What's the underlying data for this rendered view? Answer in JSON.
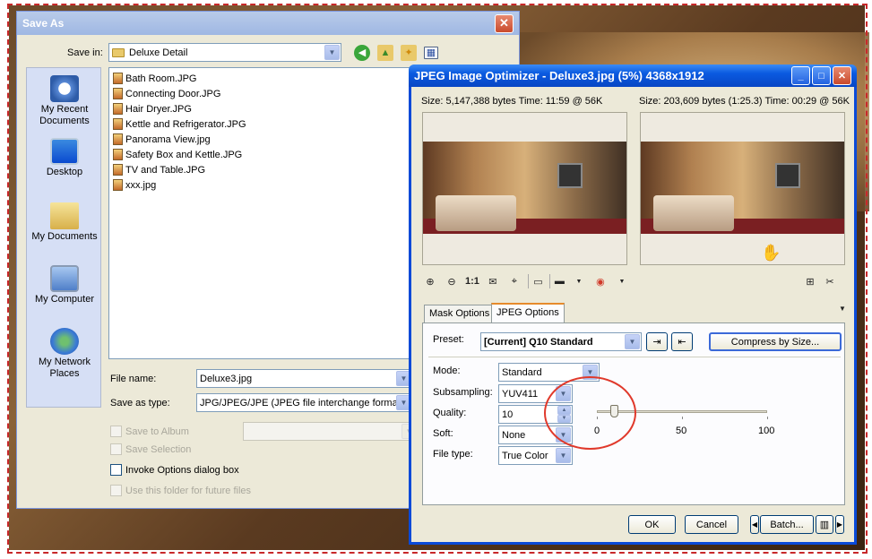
{
  "save_as": {
    "title": "Save As",
    "save_in_label": "Save in:",
    "save_in_value": "Deluxe Detail",
    "places": [
      {
        "label": "My Recent Documents",
        "icon": "recent-documents-icon"
      },
      {
        "label": "Desktop",
        "icon": "desktop-icon"
      },
      {
        "label": "My Documents",
        "icon": "my-documents-icon"
      },
      {
        "label": "My Computer",
        "icon": "my-computer-icon"
      },
      {
        "label": "My Network Places",
        "icon": "network-places-icon"
      }
    ],
    "files": [
      "Bath Room.JPG",
      "Connecting Door.JPG",
      "Hair Dryer.JPG",
      "Kettle and Refrigerator.JPG",
      "Panorama View.jpg",
      "Safety Box and Kettle.JPG",
      "TV and Table.JPG",
      "xxx.jpg"
    ],
    "file_name_label": "File name:",
    "file_name_value": "Deluxe3.jpg",
    "save_as_type_label": "Save as type:",
    "save_as_type_value": "JPG/JPEG/JPE (JPEG file interchange format)",
    "save_to_album": "Save to Album",
    "save_selection": "Save Selection",
    "invoke_options": "Invoke Options dialog box",
    "use_folder": "Use this folder for future files"
  },
  "optimizer": {
    "title": "JPEG Image Optimizer - Deluxe3.jpg (5%) 4368x1912",
    "size_left": "Size: 5,147,388 bytes Time: 11:59 @ 56K",
    "size_right": "Size: 203,609 bytes (1:25.3) Time: 00:29 @ 56K",
    "toolbar_zoom_label": "1:1",
    "tabs": [
      "Mask Options",
      "JPEG Options"
    ],
    "active_tab": "JPEG Options",
    "preset_label": "Preset:",
    "preset_value": "[Current] Q10 Standard",
    "compress_button": "Compress by Size...",
    "mode_label": "Mode:",
    "mode_value": "Standard",
    "subsampling_label": "Subsampling:",
    "subsampling_value": "YUV411",
    "quality_label": "Quality:",
    "quality_value": "10",
    "soft_label": "Soft:",
    "soft_value": "None",
    "filetype_label": "File type:",
    "filetype_value": "True Color",
    "slider": {
      "min_label": "0",
      "mid_label": "50",
      "max_label": "100",
      "value": 10
    },
    "ok_button": "OK",
    "cancel_button": "Cancel",
    "batch_button": "Batch..."
  }
}
